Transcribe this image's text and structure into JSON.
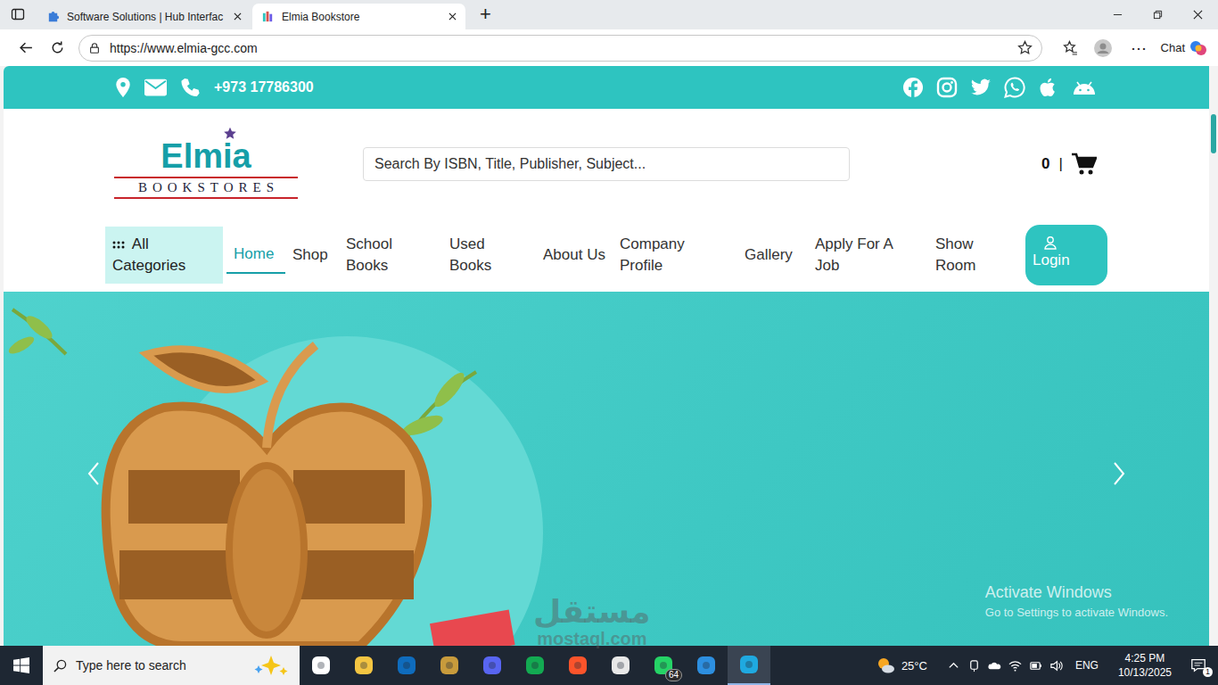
{
  "browser": {
    "tabs": [
      {
        "label": "Software Solutions | Hub Interfac",
        "selected": false
      },
      {
        "label": "Elmia Bookstore",
        "selected": true
      }
    ],
    "new_tab": "+",
    "url": "https://www.elmia-gcc.com",
    "more": "⋯",
    "chat": "Chat"
  },
  "topbar": {
    "phone": "+973 17786300"
  },
  "header": {
    "logo_name": "Elmia",
    "logo_sub": "BOOKSTORES",
    "search_placeholder": "Search By ISBN, Title, Publisher, Subject...",
    "cart_count": "0",
    "cart_separator": "|"
  },
  "nav": {
    "categories": {
      "label": "All Categories"
    },
    "items": [
      {
        "label": "Home",
        "selected": true
      },
      {
        "label": "Shop",
        "selected": false
      },
      {
        "label": "School Books",
        "selected": false
      },
      {
        "label": "Used Books",
        "selected": false
      },
      {
        "label": "About Us",
        "selected": false
      },
      {
        "label": "Company Profile",
        "selected": false
      },
      {
        "label": "Gallery",
        "selected": false
      },
      {
        "label": "Apply For A Job",
        "selected": false
      },
      {
        "label": "Show Room",
        "selected": false
      }
    ],
    "login": {
      "label": "Login"
    }
  },
  "watermark": {
    "title": "Activate Windows",
    "subtitle": "Go to Settings to activate Windows."
  },
  "site_watermark": {
    "arabic": "مستقل",
    "latin": "mostaql.com"
  },
  "taskbar": {
    "search_placeholder": "Type here to search",
    "apps": [
      {
        "color": "#ffffff",
        "active": false,
        "badge": ""
      },
      {
        "color": "#f4c542",
        "active": false,
        "badge": ""
      },
      {
        "color": "#0f6cbd",
        "active": false,
        "badge": ""
      },
      {
        "color": "#c89b3c",
        "active": false,
        "badge": ""
      },
      {
        "color": "#5865f2",
        "active": false,
        "badge": ""
      },
      {
        "color": "#13aa52",
        "active": false,
        "badge": ""
      },
      {
        "color": "#fb542b",
        "active": false,
        "badge": ""
      },
      {
        "color": "#e8e8e8",
        "active": false,
        "badge": ""
      },
      {
        "color": "#25d366",
        "active": false,
        "badge": "64"
      },
      {
        "color": "#2d8fe0",
        "active": false,
        "badge": ""
      },
      {
        "color": "#1fa9e0",
        "active": true,
        "badge": ""
      }
    ],
    "temperature": "25°C",
    "language": "ENG",
    "time": "4:25 PM",
    "date": "10/13/2025",
    "notifications": "1"
  }
}
